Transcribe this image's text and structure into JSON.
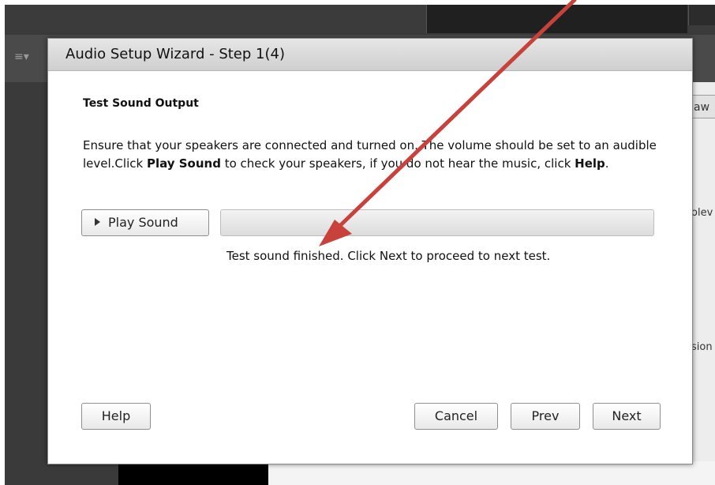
{
  "background": {
    "toolbar_icon": "≡▾",
    "right_button_label": "aw",
    "right_text_1": "olev",
    "right_text_2": "sion"
  },
  "dialog": {
    "title": "Audio Setup Wizard - Step 1(4)",
    "section_title": "Test Sound Output",
    "instructions": {
      "part1": "Ensure that your speakers are connected and turned on. The volume should be set to an audible level.Click ",
      "bold1": "Play Sound",
      "part2": " to check your speakers, if you do not hear the music, click ",
      "bold2": "Help",
      "part3": "."
    },
    "play_sound_label": "Play Sound",
    "progress_fraction": 1.0,
    "status_text": "Test sound finished. Click Next to proceed to next test.",
    "buttons": {
      "help": "Help",
      "cancel": "Cancel",
      "prev": "Prev",
      "next": "Next"
    }
  },
  "annotation": {
    "arrow_color": "#c9413b"
  }
}
